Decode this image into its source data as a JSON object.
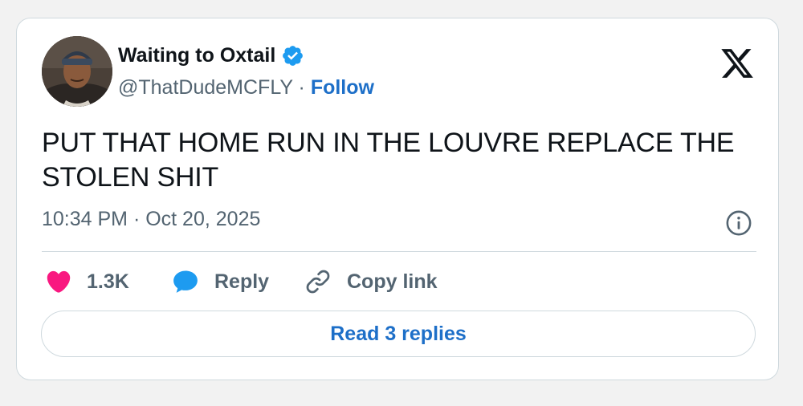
{
  "author": {
    "display_name": "Waiting to Oxtail",
    "handle": "@ThatDudeMCFLY",
    "separator": " · ",
    "follow_label": "Follow",
    "verified": true
  },
  "tweet": {
    "text": "PUT THAT HOME RUN IN THE LOUVRE REPLACE THE STOLEN SHIT",
    "timestamp": "10:34 PM · Oct 20, 2025"
  },
  "actions": {
    "like_count": "1.3K",
    "reply_label": "Reply",
    "copy_link_label": "Copy link",
    "read_replies_label": "Read 3 replies"
  },
  "icons": {
    "platform": "x-logo-icon",
    "verified": "verified-badge-icon",
    "info": "info-icon",
    "like": "heart-icon",
    "reply": "speech-bubble-icon",
    "copy": "link-icon"
  },
  "colors": {
    "link_blue": "#1d6fc8",
    "verified_blue": "#1d9bf0",
    "heart_pink": "#f91880",
    "muted_text": "#536471",
    "main_text": "#0f1419",
    "border": "#cfd9de"
  }
}
